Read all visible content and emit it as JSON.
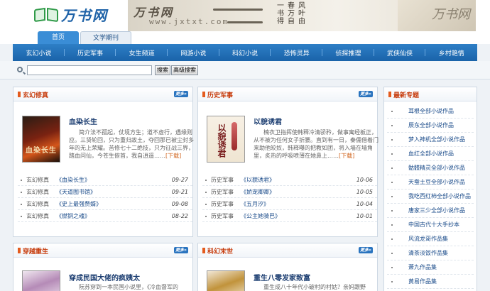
{
  "logo": {
    "text": "万书网"
  },
  "banner": {
    "brush": "万书网",
    "site": "www.jxtxt.com",
    "poem": [
      [
        "一",
        "书",
        "得"
      ],
      [
        "春",
        "万",
        "自"
      ],
      [
        "风",
        "叶",
        "由"
      ]
    ]
  },
  "tabs": [
    {
      "label": "首页",
      "active": true
    },
    {
      "label": "文学期刊",
      "active": false
    }
  ],
  "nav": [
    "玄幻小说",
    "历史军事",
    "女生频道",
    "网游小说",
    "科幻小说",
    "恐怖灵异",
    "侦探推理",
    "武侠仙侠",
    "乡村艳情"
  ],
  "search": {
    "value": "",
    "search_label": "搜索",
    "advanced_label": "高级搜索"
  },
  "more_label": "更多»",
  "panels": [
    {
      "title": "玄幻修真",
      "feature": {
        "title": "血染长生",
        "cover_text": "血染长生",
        "desc": "简介法不孤起，仗境方生；道不虚行，遇缘则应。三贤轮回，只为重归故土，夺回那已被尘封多年的无上荣耀。苦修七十二绝技，只为征战三界，踏血问仙，今苍生俯首，我自逍遥……",
        "download": "[下载]"
      },
      "items": [
        {
          "cat": "玄幻修真",
          "name": "《血染长生》",
          "date": "09-27"
        },
        {
          "cat": "玄幻修真",
          "name": "《天道图书馆》",
          "date": "09-21"
        },
        {
          "cat": "玄幻修真",
          "name": "《史上最强赘婿》",
          "date": "09-08"
        },
        {
          "cat": "玄幻修真",
          "name": "《燃铜之魂》",
          "date": "08-22"
        }
      ]
    },
    {
      "title": "历史军事",
      "feature": {
        "title": "以貌诱君",
        "cover_text": "以貌诱君",
        "desc": "楠衣卫指挥使韩释冷清骄矜，做事寓经板正，从不被为任何女子折腰。直到有一日，秦儒借着门来助他皎奴，韩释曝的把教如团，将入墙在墙角里，炙热的呼吸喷薄在她鼻上……",
        "download": "[下载]"
      },
      "items": [
        {
          "cat": "历史军事",
          "name": "《以貌诱君》",
          "date": "10-06"
        },
        {
          "cat": "历史军事",
          "name": "《娇宠卿卿》",
          "date": "10-05"
        },
        {
          "cat": "历史军事",
          "name": "《五月汐》",
          "date": "10-04"
        },
        {
          "cat": "历史军事",
          "name": "《公主她骑巴》",
          "date": "10-01"
        }
      ]
    }
  ],
  "bottom_panels": [
    {
      "title": "穿越重生",
      "feature": {
        "title": "穿成民国大佬的疯姨太",
        "desc": "阮苏穿到一本民国小说里，《冷血督军的"
      }
    },
    {
      "title": "科幻末世",
      "feature": {
        "title": "重生八零发家致富",
        "desc": "重生成八十年代小破村的村姑？亲妈跟野"
      }
    }
  ],
  "sidebar": {
    "title": "最新专题",
    "items": [
      "耳根全部小说作品",
      "辰东全部小说作品",
      "梦入神机全部小说作品",
      "血红全部小说作品",
      "骷髅精灵全部小说作品",
      "天蚕土豆全部小说作品",
      "我吃西红柿全部小说作品",
      "唐家三少全部小说作品",
      "中国古代十大手抄本",
      "风流龙哥作品集",
      "清茶淡饭作品集",
      "萧九作品集",
      "黄易作品集"
    ]
  }
}
